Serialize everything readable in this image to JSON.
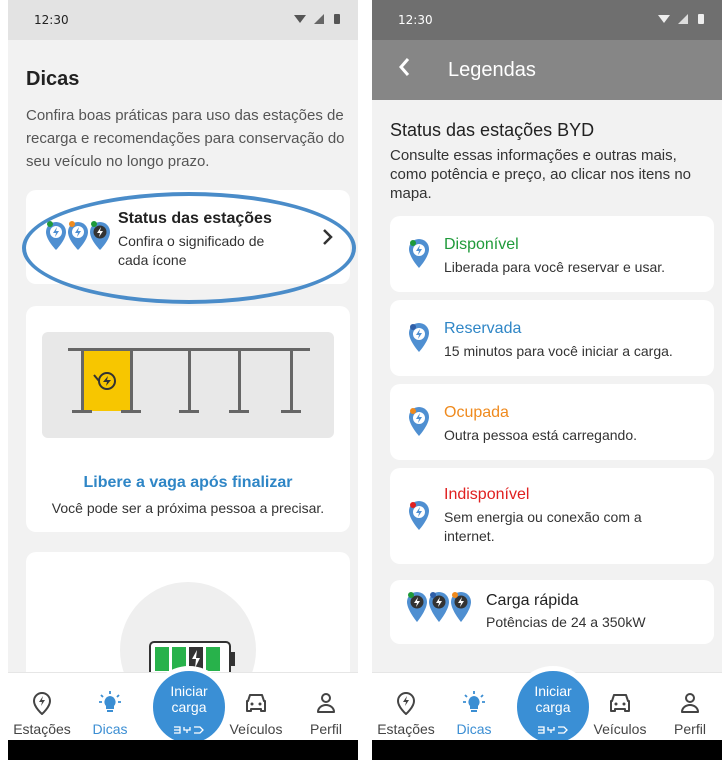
{
  "status_bar": {
    "time": "12:30"
  },
  "left": {
    "title": "Dicas",
    "description": "Confira boas práticas para uso das estações de recarga e recomendações para conservação do seu veículo no longo prazo.",
    "status_card": {
      "title": "Status das estações",
      "subtitle": "Confira o significado de cada ícone"
    },
    "parking_tip": {
      "title": "Libere a vaga após finalizar",
      "subtitle": "Você pode ser a próxima pessoa a precisar."
    }
  },
  "right": {
    "appbar_title": "Legendas",
    "title": "Status das estações BYD",
    "description": "Consulte essas informações e outras mais, como potência e preço, ao clicar nos itens no mapa.",
    "legend": [
      {
        "label": "Disponível",
        "text": "Liberada para você reservar e usar.",
        "color": "#1f9a3a"
      },
      {
        "label": "Reservada",
        "text": "15 minutos para você iniciar a carga.",
        "color": "#2f86c6"
      },
      {
        "label": "Ocupada",
        "text": "Outra pessoa está carregando.",
        "color": "#ef8a1e"
      },
      {
        "label": "Indisponível",
        "text": "Sem energia ou conexão com a internet.",
        "color": "#e02020"
      }
    ],
    "fast_charge": {
      "label": "Carga rápida",
      "text": "Potências de 24 a 350kW"
    }
  },
  "nav": {
    "items": [
      {
        "label": "Estações",
        "icon": "map-pin-icon"
      },
      {
        "label": "Dicas",
        "icon": "lightbulb-icon"
      },
      {
        "label": "Veículos",
        "icon": "car-icon"
      },
      {
        "label": "Perfil",
        "icon": "person-icon"
      }
    ],
    "fab_label": "Iniciar carga",
    "fab_logo": "BYD"
  },
  "colors": {
    "accent": "#3a8fd5",
    "pin_blue": "#4f8fd1",
    "slot_yellow": "#f7c600"
  }
}
